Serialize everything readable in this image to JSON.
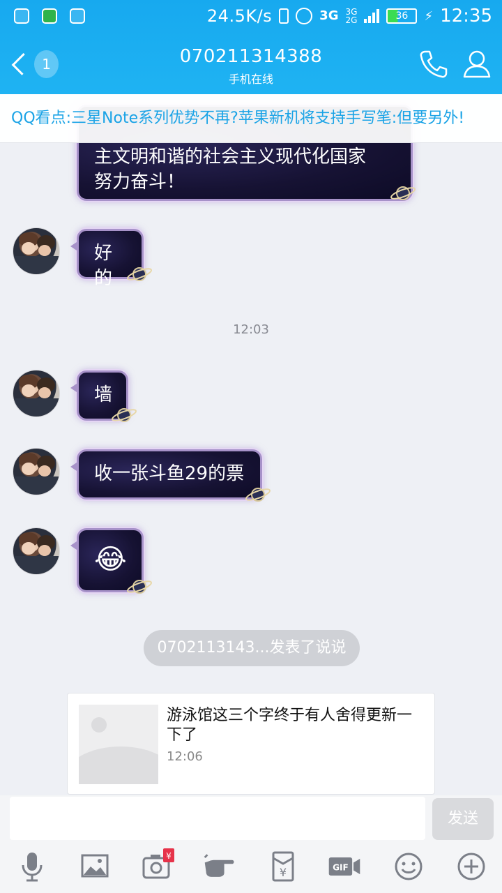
{
  "status_bar": {
    "net_speed": "24.5K/s",
    "net_type": "3G",
    "net_type2_top": "3G",
    "net_type2_bottom": "2G",
    "battery": "36",
    "time": "12:35"
  },
  "header": {
    "unread_count": "1",
    "title": "070211314388",
    "subtitle": "手机在线"
  },
  "banner": {
    "text": "QQ看点:三星Note系列优势不再?苹果新机将支持手写笔:但要另外!"
  },
  "messages": [
    {
      "text": "主文明和谐的社会主义现代化国家\n努力奋斗！"
    },
    {
      "text": "好的"
    },
    {
      "time": "12:03"
    },
    {
      "text": "墙"
    },
    {
      "text": "收一张斗鱼29的票"
    },
    {
      "text": "😂"
    }
  ],
  "feed": {
    "pill": "0702113143...发表了说说",
    "card_text": "游泳馆这三个字终于有人舍得更新一下了",
    "card_time": "12:06"
  },
  "input": {
    "placeholder": "",
    "send_label": "发送"
  },
  "toolbar_icons": [
    "microphone-icon",
    "image-icon",
    "camera-icon",
    "poke-icon",
    "red-packet-icon",
    "gif-icon",
    "emoji-icon",
    "plus-icon"
  ],
  "colors": {
    "accent": "#18abef",
    "bubble_bg": "#161233",
    "bubble_border": "#a792c9"
  }
}
